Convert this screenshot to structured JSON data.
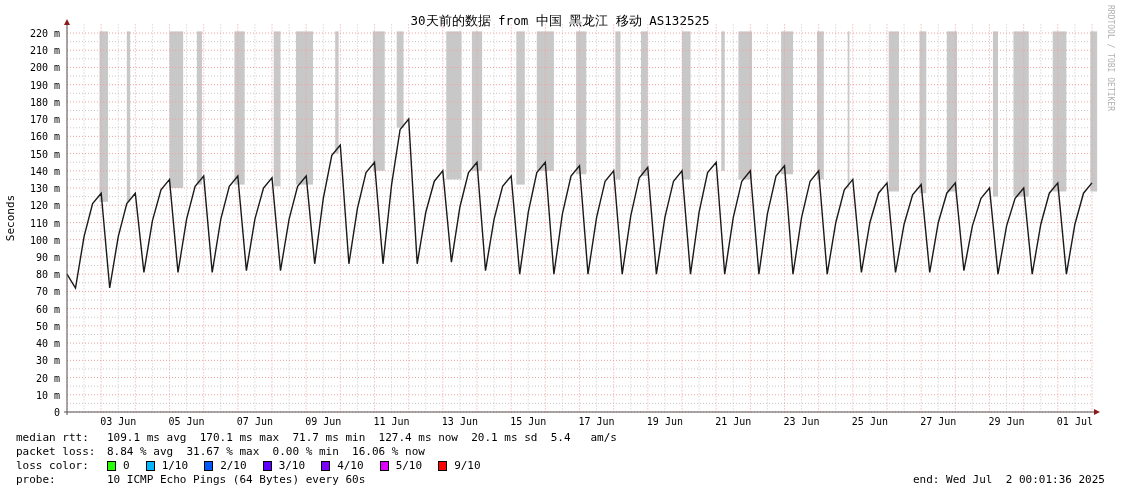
{
  "graph": {
    "credit": "RRDTOOL / TOBI OETIKER",
    "chart_data": {
      "type": "line",
      "title": "30天前的数据 from 中国 黑龙江 移动 AS132525",
      "ylabel": "Seconds",
      "grid": true,
      "ylim": [
        0,
        225
      ],
      "yticks": [
        {
          "value": 0,
          "label": "0"
        },
        {
          "value": 10,
          "label": "10 m"
        },
        {
          "value": 20,
          "label": "20 m"
        },
        {
          "value": 30,
          "label": "30 m"
        },
        {
          "value": 40,
          "label": "40 m"
        },
        {
          "value": 50,
          "label": "50 m"
        },
        {
          "value": 60,
          "label": "60 m"
        },
        {
          "value": 70,
          "label": "70 m"
        },
        {
          "value": 80,
          "label": "80 m"
        },
        {
          "value": 90,
          "label": "90 m"
        },
        {
          "value": 100,
          "label": "100 m"
        },
        {
          "value": 110,
          "label": "110 m"
        },
        {
          "value": 120,
          "label": "120 m"
        },
        {
          "value": 130,
          "label": "130 m"
        },
        {
          "value": 140,
          "label": "140 m"
        },
        {
          "value": 150,
          "label": "150 m"
        },
        {
          "value": 160,
          "label": "160 m"
        },
        {
          "value": 170,
          "label": "170 m"
        },
        {
          "value": 180,
          "label": "180 m"
        },
        {
          "value": 190,
          "label": "190 m"
        },
        {
          "value": 200,
          "label": "200 m"
        },
        {
          "value": 210,
          "label": "210 m"
        },
        {
          "value": 220,
          "label": "220 m"
        }
      ],
      "categories": [
        null,
        null,
        null,
        null,
        null,
        null,
        "03 Jun",
        null,
        null,
        null,
        null,
        null,
        null,
        null,
        "05 Jun",
        null,
        null,
        null,
        null,
        null,
        null,
        null,
        "07 Jun",
        null,
        null,
        null,
        null,
        null,
        null,
        null,
        "09 Jun",
        null,
        null,
        null,
        null,
        null,
        null,
        null,
        "11 Jun",
        null,
        null,
        null,
        null,
        null,
        null,
        null,
        "13 Jun",
        null,
        null,
        null,
        null,
        null,
        null,
        null,
        "15 Jun",
        null,
        null,
        null,
        null,
        null,
        null,
        null,
        "17 Jun",
        null,
        null,
        null,
        null,
        null,
        null,
        null,
        "19 Jun",
        null,
        null,
        null,
        null,
        null,
        null,
        null,
        "21 Jun",
        null,
        null,
        null,
        null,
        null,
        null,
        null,
        "23 Jun",
        null,
        null,
        null,
        null,
        null,
        null,
        null,
        "25 Jun",
        null,
        null,
        null,
        null,
        null,
        null,
        null,
        "27 Jun",
        null,
        null,
        null,
        null,
        null,
        null,
        null,
        "29 Jun",
        null,
        null,
        null,
        null,
        null,
        null,
        null,
        "01 Jul",
        null,
        null
      ],
      "series": [
        {
          "color": "#1a1a1a",
          "values": [
            80,
            72,
            102,
            121,
            127,
            72,
            102,
            121,
            127,
            81,
            111,
            129,
            135,
            81,
            112,
            131,
            137,
            81,
            112,
            131,
            137,
            82,
            112,
            130,
            136,
            82,
            112,
            131,
            137,
            86,
            124,
            149,
            155,
            86,
            118,
            139,
            145,
            86,
            132,
            164,
            170,
            86,
            116,
            134,
            140,
            87,
            119,
            139,
            145,
            82,
            112,
            131,
            137,
            80,
            116,
            139,
            145,
            80,
            115,
            137,
            143,
            80,
            113,
            134,
            140,
            80,
            114,
            136,
            142,
            80,
            113,
            134,
            140,
            80,
            116,
            139,
            145,
            80,
            113,
            134,
            140,
            80,
            115,
            137,
            143,
            80,
            113,
            134,
            140,
            80,
            110,
            129,
            135,
            81,
            110,
            127,
            133,
            81,
            109,
            126,
            132,
            81,
            110,
            127,
            133,
            82,
            108,
            124,
            130,
            80,
            108,
            124,
            130,
            80,
            109,
            127,
            133,
            80,
            109,
            127,
            133
          ]
        }
      ]
    }
  },
  "legend": {
    "rows": [
      {
        "label": "median rtt:",
        "text": "109.1 ms avg  170.1 ms max  71.7 ms min  127.4 ms now  20.1 ms sd  5.4   am/s"
      },
      {
        "label": "packet loss:",
        "text": "8.84 % avg  31.67 % max  0.00 % min  16.06 % now"
      }
    ],
    "loss_color": {
      "label": "loss color:",
      "items": [
        {
          "label": "0",
          "color": "#26ff00"
        },
        {
          "label": "1/10",
          "color": "#00b8ff"
        },
        {
          "label": "2/10",
          "color": "#0059ff"
        },
        {
          "label": "3/10",
          "color": "#5e00ff"
        },
        {
          "label": "4/10",
          "color": "#7e00ff"
        },
        {
          "label": "5/10",
          "color": "#dd00ff"
        },
        {
          "label": "9/10",
          "color": "#ff0000"
        }
      ]
    },
    "probe": {
      "label": "probe:",
      "text": "10 ICMP Echo Pings (64 Bytes) every 60s"
    },
    "end": "end: Wed Jul  2 00:01:36 2025"
  }
}
